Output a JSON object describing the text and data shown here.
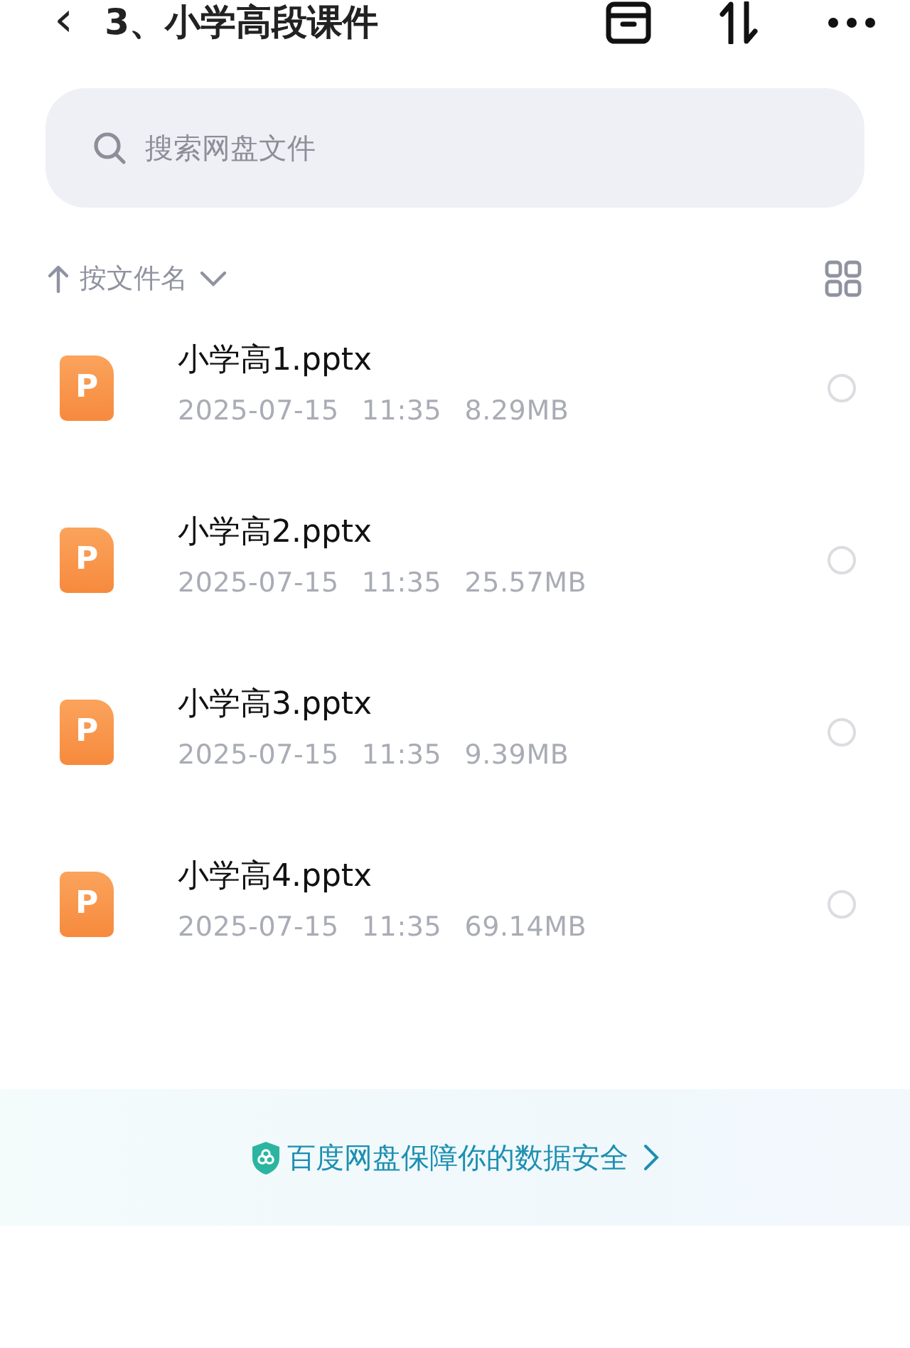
{
  "header": {
    "back": "‹",
    "title": "3、小学高段课件"
  },
  "search": {
    "placeholder": "搜索网盘文件"
  },
  "sort": {
    "label": "按文件名"
  },
  "files": [
    {
      "badge": "P",
      "name": "小学高1.pptx",
      "date": "2025-07-15",
      "time": "11:35",
      "size": "8.29MB",
      "selected": false
    },
    {
      "badge": "P",
      "name": "小学高2.pptx",
      "date": "2025-07-15",
      "time": "11:35",
      "size": "25.57MB",
      "selected": false
    },
    {
      "badge": "P",
      "name": "小学高3.pptx",
      "date": "2025-07-15",
      "time": "11:35",
      "size": "9.39MB",
      "selected": false
    },
    {
      "badge": "P",
      "name": "小学高4.pptx",
      "date": "2025-07-15",
      "time": "11:35",
      "size": "69.14MB",
      "selected": false
    }
  ],
  "footer": {
    "text": "百度网盘保障你的数据安全"
  }
}
